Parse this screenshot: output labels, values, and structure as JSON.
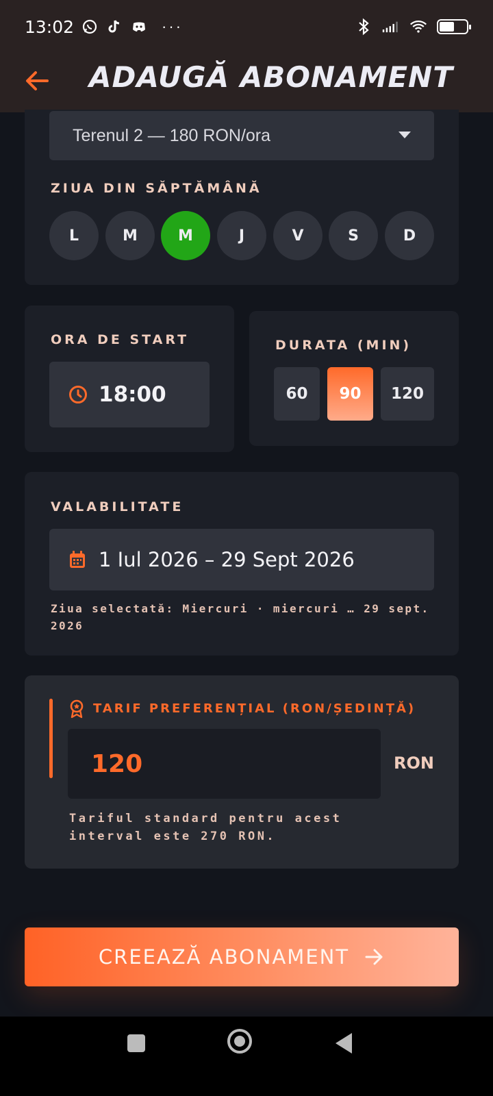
{
  "status_bar": {
    "time": "13:02",
    "left_icons": [
      "whatsapp-icon",
      "tiktok-icon",
      "discord-icon"
    ],
    "more": "···",
    "right_icons": [
      "bluetooth-icon",
      "signal-icon",
      "wifi-icon",
      "battery-icon"
    ],
    "battery_level": 0.55
  },
  "header": {
    "title": "ADAUGĂ ABONAMENT",
    "back_icon": "arrow-left-icon"
  },
  "court_select": {
    "value": "Terenul 2 — 180 RON/ora"
  },
  "weekday": {
    "label": "ZIUA DIN SĂPTĂMÂNĂ",
    "days": [
      "L",
      "M",
      "M",
      "J",
      "V",
      "S",
      "D"
    ],
    "selected_index": 2
  },
  "start_time": {
    "label": "ORA DE START",
    "value": "18:00",
    "icon": "clock-icon"
  },
  "duration": {
    "label": "DURATA (MIN)",
    "options": [
      "60",
      "90",
      "120"
    ],
    "selected": "90"
  },
  "validity": {
    "label": "VALABILITATE",
    "value": "1 Iul 2026 – 29 Sept 2026",
    "icon": "calendar-icon",
    "note": "Ziua selectată: Miercuri · miercuri … 29 sept. 2026"
  },
  "preferential_rate": {
    "label": "TARIF PREFERENȚIAL (RON/ȘEDINȚĂ)",
    "icon": "badge-icon",
    "value": "120",
    "unit": "RON",
    "note": "Tariful standard pentru acest interval este 270 RON."
  },
  "cta": {
    "label": "CREEAZĂ ABONAMENT"
  },
  "colors": {
    "accent": "#ff6a2a",
    "selected_day": "#22a617",
    "background": "#12151c",
    "card": "#1c1f27"
  }
}
